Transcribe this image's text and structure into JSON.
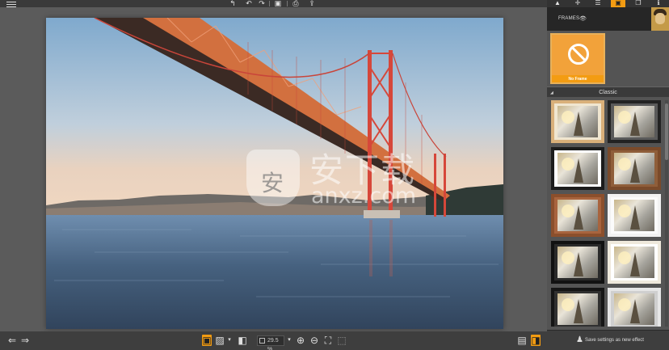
{
  "top_toolbar": {
    "menu_icon": "hamburger-icon",
    "tools": [
      {
        "icon": "rotate-left-icon",
        "glyph": "↰"
      },
      {
        "icon": "undo-icon",
        "glyph": "↶"
      },
      {
        "icon": "redo-icon",
        "glyph": "↷"
      },
      {
        "icon": "save-icon",
        "glyph": "▣"
      },
      {
        "icon": "print-icon",
        "glyph": "⎙"
      },
      {
        "icon": "share-icon",
        "glyph": "⇪"
      }
    ]
  },
  "right_tabs": [
    {
      "icon": "light-icon",
      "glyph": "▲"
    },
    {
      "icon": "crop-icon",
      "glyph": "✛"
    },
    {
      "icon": "adjust-icon",
      "glyph": "☰"
    },
    {
      "icon": "frames-icon",
      "glyph": "▣"
    },
    {
      "icon": "layers-icon",
      "glyph": "❐"
    },
    {
      "icon": "info-icon",
      "glyph": "ℹ"
    }
  ],
  "frames_panel": {
    "header": "FRAMES",
    "eye_glyph": "👁",
    "no_frame_label": "No Frame",
    "section_title": "Classic",
    "section_toggle": "◢",
    "frames": [
      {
        "name": "light-wood-frame",
        "border": "#d9b07a",
        "mat": "#f0e6d0"
      },
      {
        "name": "dark-frame",
        "border": "#222222",
        "mat": "#5a5a5a"
      },
      {
        "name": "black-white-frame",
        "border": "#1c1c1c",
        "mat": "#ffffff"
      },
      {
        "name": "brown-wood-frame",
        "border": "#7a4a2a",
        "mat": "#8f5e3a"
      },
      {
        "name": "ornate-brown-frame",
        "border": "#8b4f2c",
        "mat": "#a8643e"
      },
      {
        "name": "white-frame",
        "border": "#f2f2f2",
        "mat": "#fbfbfb"
      },
      {
        "name": "black-frame",
        "border": "#111111",
        "mat": "#2a2a2a"
      },
      {
        "name": "cream-frame",
        "border": "#efe9dc",
        "mat": "#ffffff"
      },
      {
        "name": "black-thin-frame",
        "border": "#151515",
        "mat": "#303030"
      },
      {
        "name": "light-frame",
        "border": "#e6e6e6",
        "mat": "#cfcfcf"
      }
    ],
    "save_label": "Save settings as new effect",
    "save_glyph": "♟"
  },
  "bottom_toolbar": {
    "nav": [
      {
        "icon": "back-icon",
        "glyph": "⇐"
      },
      {
        "icon": "forward-icon",
        "glyph": "⇒"
      }
    ],
    "view_tools": [
      {
        "icon": "single-view-icon",
        "glyph": "▣",
        "active": true
      },
      {
        "icon": "fit-view-icon",
        "glyph": "▨"
      },
      {
        "icon": "compare-icon",
        "glyph": "◧"
      }
    ],
    "zoom_value": "29.5 %",
    "zoom_tools": [
      {
        "icon": "zoom-in-icon",
        "glyph": "⊕"
      },
      {
        "icon": "zoom-out-icon",
        "glyph": "⊖"
      },
      {
        "icon": "fit-screen-icon",
        "glyph": "⛶"
      },
      {
        "icon": "actual-size-icon",
        "glyph": "⬚"
      }
    ],
    "right_tools": [
      {
        "icon": "export-icon",
        "glyph": "▤"
      },
      {
        "icon": "panel-toggle-icon",
        "glyph": "◨",
        "active": true
      }
    ]
  },
  "watermark": {
    "cn": "安下载",
    "en": "anxz.com",
    "shield": "安"
  }
}
